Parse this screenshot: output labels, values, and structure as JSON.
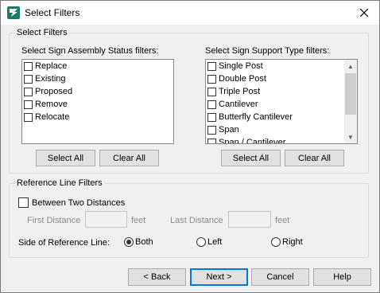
{
  "window": {
    "title": "Select Filters",
    "app_icon": "flag-icon",
    "close_icon": "close-icon"
  },
  "select_filters": {
    "group_label": "Select Filters",
    "assembly": {
      "label": "Select Sign Assembly Status filters:",
      "items": [
        "Replace",
        "Existing",
        "Proposed",
        "Remove",
        "Relocate"
      ],
      "select_all_label": "Select All",
      "clear_all_label": "Clear All"
    },
    "support": {
      "label": "Select Sign Support Type filters:",
      "items": [
        "Single Post",
        "Double Post",
        "Triple Post",
        "Cantilever",
        "Butterfly Cantilever",
        "Span",
        "Span / Cantilever"
      ],
      "select_all_label": "Select All",
      "clear_all_label": "Clear All"
    }
  },
  "reference_line": {
    "group_label": "Reference Line Filters",
    "between_label": "Between Two Distances",
    "between_checked": false,
    "first_distance_label": "First Distance",
    "first_unit": "feet",
    "last_distance_label": "Last Distance",
    "last_unit": "feet",
    "side_label": "Side of Reference Line:",
    "side_options": [
      "Both",
      "Left",
      "Right"
    ],
    "side_selected": "Both"
  },
  "footer": {
    "back_label": "< Back",
    "next_label": "Next >",
    "cancel_label": "Cancel",
    "help_label": "Help"
  }
}
